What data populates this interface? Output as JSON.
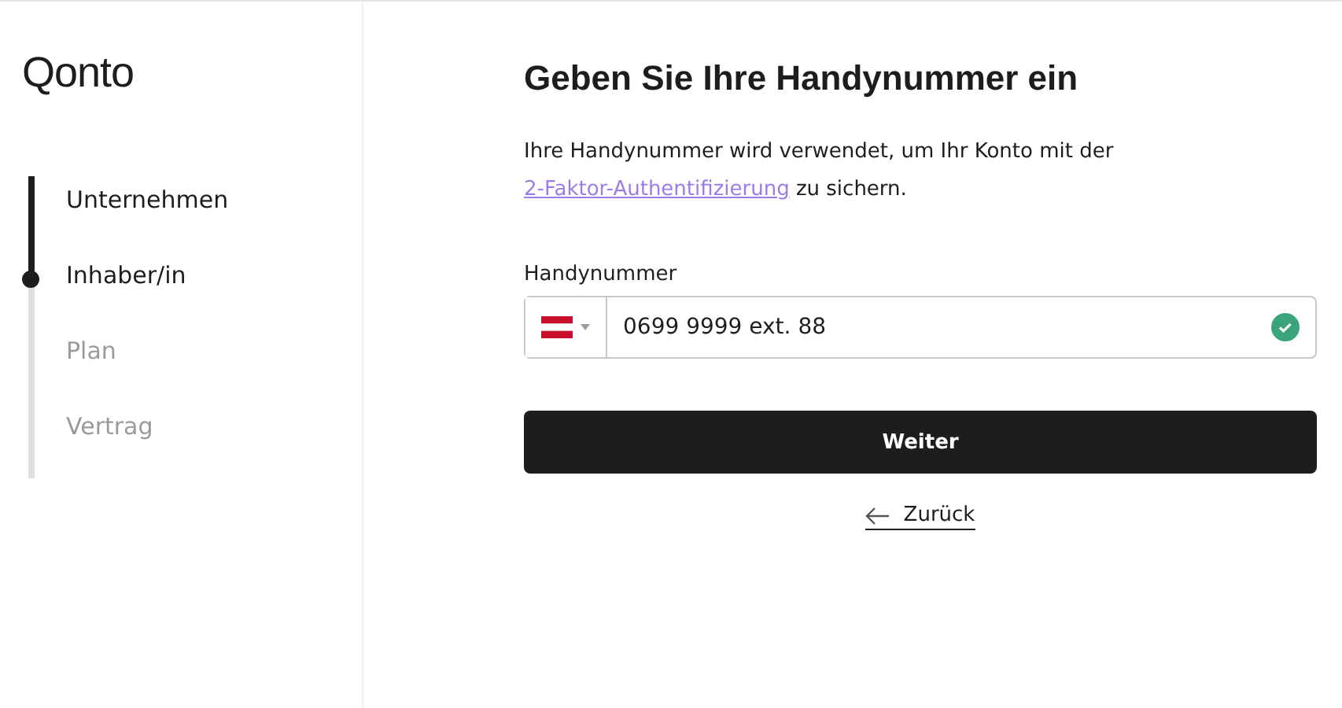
{
  "logo": "Qonto",
  "steps": [
    {
      "label": "Unternehmen",
      "completed": true,
      "selected": false
    },
    {
      "label": "Inhaber/in",
      "completed": true,
      "selected": true
    },
    {
      "label": "Plan",
      "completed": false,
      "selected": false
    },
    {
      "label": "Vertrag",
      "completed": false,
      "selected": false
    }
  ],
  "heading": "Geben Sie Ihre Handynummer ein",
  "description": {
    "before": "Ihre Handynummer wird verwendet, um Ihr Konto mit der ",
    "link": "2-Faktor-Authentifizierung",
    "after": " zu sichern."
  },
  "phone_field": {
    "label": "Handynummer",
    "value": "0699 9999 ext. 88",
    "valid": true
  },
  "primary_button": "Weiter",
  "back_link": "Zurück"
}
